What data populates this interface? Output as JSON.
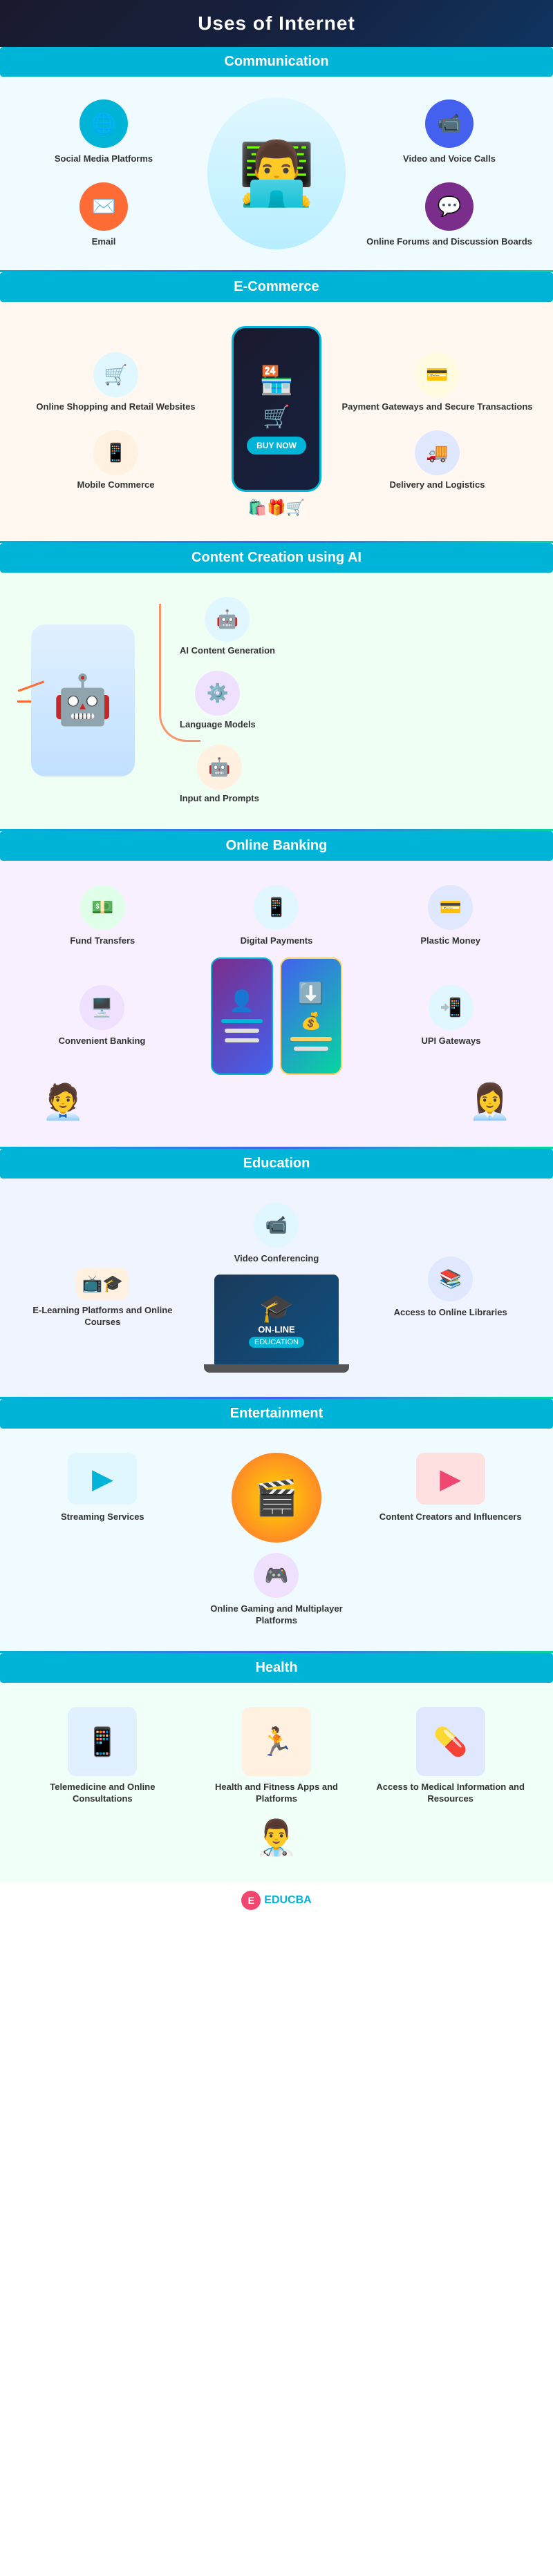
{
  "page": {
    "title": "Uses of Internet"
  },
  "sections": {
    "communication": {
      "header": "Communication",
      "items": [
        {
          "label": "Social Media Platforms",
          "icon": "🌐",
          "bg": "ic-teal"
        },
        {
          "label": "Video and Voice Calls",
          "icon": "▶",
          "bg": "ic-blue"
        },
        {
          "label": "Email",
          "icon": "✉",
          "bg": "ic-orange"
        },
        {
          "label": "Online Forums and Discussion Boards",
          "icon": "💬",
          "bg": "ic-purple"
        }
      ],
      "center_icon": "👨‍💻"
    },
    "ecommerce": {
      "header": "E-Commerce",
      "items": [
        {
          "label": "Online Shopping and Retail Websites",
          "icon": "🛒",
          "bg": "bg-teal"
        },
        {
          "label": "Payment Gateways and Secure Transactions",
          "icon": "💳",
          "bg": "bg-yellow"
        },
        {
          "label": "Mobile Commerce",
          "icon": "📱",
          "bg": "bg-orange"
        },
        {
          "label": "Delivery and Logistics",
          "icon": "🚚",
          "bg": "bg-blue"
        }
      ],
      "center": {
        "shop_icon": "🏪",
        "cart_icon": "🛒",
        "buy_label": "BUY NOW"
      }
    },
    "ai": {
      "header": "Content Creation using AI",
      "items": [
        {
          "label": "AI Content Generation",
          "icon": "🤖",
          "bg": "bg-teal"
        },
        {
          "label": "Language Models",
          "icon": "⚙",
          "bg": "bg-purple"
        },
        {
          "label": "Input and Prompts",
          "icon": "🤖",
          "bg": "bg-orange"
        }
      ],
      "robot_icon": "🤖"
    },
    "banking": {
      "header": "Online Banking",
      "top_items": [
        {
          "label": "Fund Transfers",
          "icon": "💵",
          "bg": "bg-green"
        },
        {
          "label": "Digital Payments",
          "icon": "📱",
          "bg": "bg-teal"
        },
        {
          "label": "Plastic Money",
          "icon": "💳",
          "bg": "bg-blue"
        }
      ],
      "bottom_items": [
        {
          "label": "Convenient Banking",
          "icon": "🖥",
          "bg": "bg-purple"
        },
        {
          "label": "UPI Gateways",
          "icon": "📲",
          "bg": "bg-teal"
        }
      ]
    },
    "education": {
      "header": "Education",
      "items_left": [
        {
          "label": "E-Learning Platforms and Online Courses",
          "icon": "🎓",
          "bg": "bg-orange"
        }
      ],
      "items_top": [
        {
          "label": "Video Conferencing",
          "icon": "📹",
          "bg": "bg-teal"
        }
      ],
      "items_right": [
        {
          "label": "Access to Online Libraries",
          "icon": "📚",
          "bg": "bg-blue"
        }
      ],
      "laptop": {
        "line1": "ON-LINE",
        "line2": "EDUCATION",
        "icon": "💻"
      }
    },
    "entertainment": {
      "header": "Entertainment",
      "items": [
        {
          "label": "Streaming Services",
          "icon": "▶",
          "bg": "bg-teal"
        },
        {
          "label": "Content Creators and Influencers",
          "icon": "▶",
          "bg": "bg-red"
        },
        {
          "label": "Online Gaming and Multiplayer Platforms",
          "icon": "🎮",
          "bg": "bg-purple"
        }
      ],
      "center_icon": "🎬"
    },
    "health": {
      "header": "Health",
      "items": [
        {
          "label": "Telemedicine and Online Consultations",
          "icon": "📱",
          "bg": "bg-teal"
        },
        {
          "label": "Health and Fitness Apps and Platforms",
          "icon": "🏃",
          "bg": "bg-orange"
        },
        {
          "label": "Access to Medical Information and Resources",
          "icon": "💊",
          "bg": "bg-blue"
        }
      ]
    }
  },
  "footer": {
    "logo_letter": "E",
    "brand": "EDUCBA"
  }
}
